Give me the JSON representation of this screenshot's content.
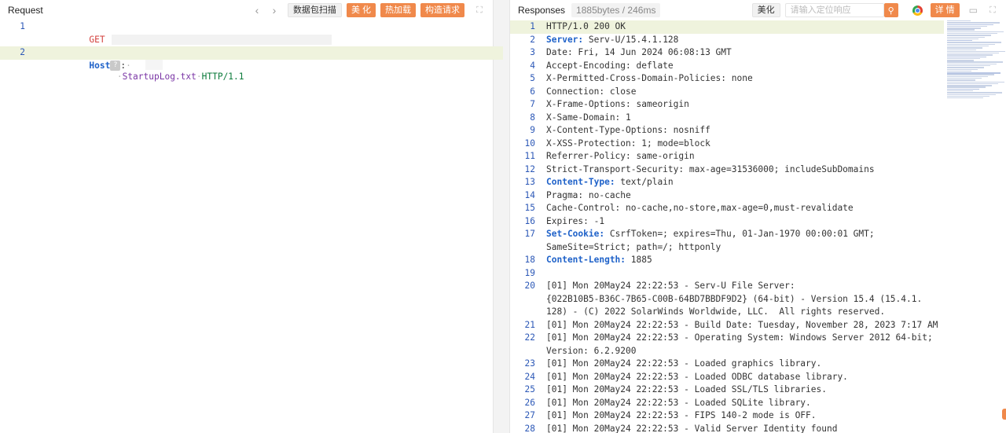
{
  "request": {
    "title": "Request",
    "buttons": {
      "scan": "数据包扫描",
      "beautify": "美 化",
      "hot_load": "热加载",
      "build": "构造请求"
    },
    "lines": [
      {
        "num": "1",
        "method": "GET",
        "path": "StartupLog.txt",
        "protocol": "HTTP/1.1"
      },
      {
        "num": "2",
        "header": "Host",
        "badge": "?",
        "sep": ":"
      }
    ]
  },
  "response": {
    "title": "Responses",
    "size": "1885bytes / 246ms",
    "beautify": "美化",
    "search_placeholder": "请输入定位响应",
    "detail": "详 情",
    "lines": [
      {
        "num": "1",
        "text": "HTTP/1.0 200 OK"
      },
      {
        "num": "2",
        "key": "Server:",
        "text": " Serv-U/15.4.1.128"
      },
      {
        "num": "3",
        "text": "Date: Fri, 14 Jun 2024 06:08:13 GMT"
      },
      {
        "num": "4",
        "text": "Accept-Encoding: deflate"
      },
      {
        "num": "5",
        "text": "X-Permitted-Cross-Domain-Policies: none"
      },
      {
        "num": "6",
        "text": "Connection: close"
      },
      {
        "num": "7",
        "text": "X-Frame-Options: sameorigin"
      },
      {
        "num": "8",
        "text": "X-Same-Domain: 1"
      },
      {
        "num": "9",
        "text": "X-Content-Type-Options: nosniff"
      },
      {
        "num": "10",
        "text": "X-XSS-Protection: 1; mode=block"
      },
      {
        "num": "11",
        "text": "Referrer-Policy: same-origin"
      },
      {
        "num": "12",
        "text": "Strict-Transport-Security: max-age=31536000; includeSubDomains"
      },
      {
        "num": "13",
        "key": "Content-Type:",
        "text": " text/plain"
      },
      {
        "num": "14",
        "text": "Pragma: no-cache"
      },
      {
        "num": "15",
        "text": "Cache-Control: no-cache,no-store,max-age=0,must-revalidate"
      },
      {
        "num": "16",
        "text": "Expires: -1"
      },
      {
        "num": "17",
        "key": "Set-Cookie:",
        "text": " CsrfToken=; expires=Thu, 01-Jan-1970 00:00:01 GMT;"
      },
      {
        "num": "",
        "text": "SameSite=Strict; path=/; httponly"
      },
      {
        "num": "18",
        "key": "Content-Length:",
        "text": " 1885"
      },
      {
        "num": "19",
        "text": ""
      },
      {
        "num": "20",
        "text": "[01] Mon 20May24 22:22:53 - Serv-U File Server:"
      },
      {
        "num": "",
        "text": "{022B10B5-B36C-7B65-C00B-64BD7BBDF9D2} (64-bit) - Version 15.4 (15.4.1."
      },
      {
        "num": "",
        "text": "128) - (C) 2022 SolarWinds Worldwide, LLC.  All rights reserved."
      },
      {
        "num": "21",
        "text": "[01] Mon 20May24 22:22:53 - Build Date: Tuesday, November 28, 2023 7:17 AM"
      },
      {
        "num": "22",
        "text": "[01] Mon 20May24 22:22:53 - Operating System: Windows Server 2012 64-bit;"
      },
      {
        "num": "",
        "text": "Version: 6.2.9200"
      },
      {
        "num": "23",
        "text": "[01] Mon 20May24 22:22:53 - Loaded graphics library."
      },
      {
        "num": "24",
        "text": "[01] Mon 20May24 22:22:53 - Loaded ODBC database library."
      },
      {
        "num": "25",
        "text": "[01] Mon 20May24 22:22:53 - Loaded SSL/TLS libraries."
      },
      {
        "num": "26",
        "text": "[01] Mon 20May24 22:22:53 - Loaded SQLite library."
      },
      {
        "num": "27",
        "text": "[01] Mon 20May24 22:22:53 - FIPS 140-2 mode is OFF."
      },
      {
        "num": "28",
        "text": "[01] Mon 20May24 22:22:53 - Valid Server Identity found"
      }
    ]
  },
  "colors": {
    "accent": "#f0894b",
    "line_number": "#2d59b7",
    "highlight": "#eff3dd",
    "key": "#1f62c9"
  }
}
